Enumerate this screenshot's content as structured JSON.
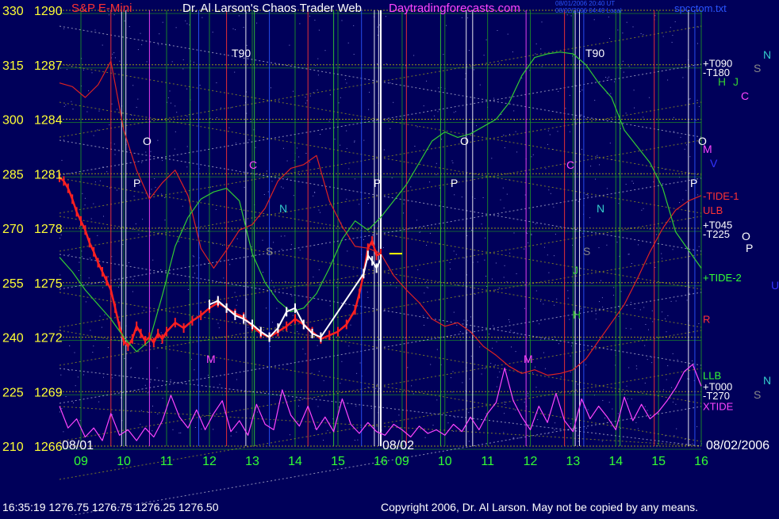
{
  "header": {
    "instrument": "S&P E-Mini",
    "site_title": "Dr. Al Larson's Chaos Trader Web",
    "site_url": "Daytradingforecasts.com",
    "stamp_line1": "08/01/2006 20:40 UT",
    "stamp_line2": "08/02/2006 04:40 Local",
    "file_name": "spcctom.txt"
  },
  "footer": {
    "quote": "16:35:19  1276.75 1276.75 1276.25 1276.50",
    "copyright": "Copyright 2006, Dr. Al Larson. May not be copied by any means."
  },
  "chart_data": {
    "type": "line",
    "title": "S&P E-Mini",
    "y_axis": {
      "price_ticks": [
        "1290",
        "1287",
        "1284",
        "1281",
        "1278",
        "1275",
        "1272",
        "1269",
        "1266"
      ],
      "angle_ticks": [
        "330",
        "315",
        "300",
        "285",
        "270",
        "255",
        "240",
        "225",
        "210"
      ],
      "ylim": [
        1266,
        1290
      ]
    },
    "x_axis": {
      "hour_ticks": [
        "09",
        "10",
        "11",
        "12",
        "13",
        "14",
        "15",
        "16",
        "09",
        "10",
        "11",
        "12",
        "13",
        "14",
        "15",
        "16"
      ],
      "date_labels": [
        "08/01",
        "08/02",
        "08/02/2006"
      ],
      "session_hours": [
        8.5,
        16
      ]
    },
    "flux_labels": [
      {
        "text": "+T090",
        "price": 1287.1,
        "color": "#ffffff"
      },
      {
        "text": "-T180",
        "price": 1286.6,
        "color": "#ffffff"
      },
      {
        "text": "-TIDE-1",
        "price": 1279.8,
        "color": "#ff3333"
      },
      {
        "text": "ULB",
        "price": 1279.0,
        "color": "#ff3333"
      },
      {
        "text": "+T045",
        "price": 1278.2,
        "color": "#ffffff"
      },
      {
        "text": "-T225",
        "price": 1277.7,
        "color": "#ffffff"
      },
      {
        "text": "+TIDE-2",
        "price": 1275.3,
        "color": "#33ff33"
      },
      {
        "text": "R",
        "price": 1273.0,
        "color": "#ff3333"
      },
      {
        "text": "LLB",
        "price": 1269.9,
        "color": "#33ff33"
      },
      {
        "text": "+T000",
        "price": 1269.3,
        "color": "#ffffff"
      },
      {
        "text": "-T270",
        "price": 1268.8,
        "color": "#ffffff"
      },
      {
        "text": "XTIDE",
        "price": 1268.2,
        "color": "#ff44ff"
      }
    ],
    "planet_labels": [
      {
        "text": "N",
        "color": "#33cccc"
      },
      {
        "text": "S",
        "color": "#888888"
      },
      {
        "text": "H",
        "color": "#33cc33"
      },
      {
        "text": "J",
        "color": "#33cc33"
      },
      {
        "text": "C",
        "color": "#ff44ff"
      },
      {
        "text": "O",
        "color": "#ffffff"
      },
      {
        "text": "M",
        "color": "#ff44ff"
      },
      {
        "text": "V",
        "color": "#3333ff"
      },
      {
        "text": "P",
        "color": "#ffffff"
      },
      {
        "text": "U",
        "color": "#3333ff"
      },
      {
        "text": "T90",
        "color": "#ffffff"
      }
    ],
    "series": [
      {
        "name": "price",
        "color": "#ff2020",
        "x": [
          8.5,
          8.6,
          8.7,
          8.8,
          8.9,
          9.0,
          9.1,
          9.2,
          9.3,
          9.4,
          9.5,
          9.6,
          9.7,
          9.8,
          9.9,
          10.0,
          10.1,
          10.2,
          10.3,
          10.4,
          10.5,
          10.6,
          10.7,
          10.8,
          10.9,
          11.0,
          11.2,
          11.4,
          11.6,
          11.8,
          12.0,
          12.2,
          12.4,
          12.6,
          12.8,
          13.0,
          13.2,
          13.4,
          13.6,
          13.8,
          14.0,
          14.2,
          14.4,
          14.6,
          14.8,
          15.0,
          15.2,
          15.4,
          15.5,
          15.6,
          15.7,
          15.8,
          15.9,
          16.0
        ],
        "y": [
          1280.8,
          1280.6,
          1280.2,
          1279.6,
          1278.9,
          1278.4,
          1277.9,
          1277.2,
          1276.7,
          1276.1,
          1275.6,
          1275.1,
          1274.6,
          1273.6,
          1272.6,
          1271.8,
          1271.5,
          1271.9,
          1272.6,
          1272.2,
          1271.8,
          1272.0,
          1271.7,
          1272.2,
          1271.9,
          1272.3,
          1272.8,
          1272.5,
          1272.9,
          1273.2,
          1273.6,
          1273.9,
          1273.6,
          1273.3,
          1273.1,
          1272.6,
          1272.2,
          1272.0,
          1272.3,
          1272.6,
          1273.0,
          1272.7,
          1272.3,
          1271.9,
          1272.1,
          1272.3,
          1272.7,
          1273.5,
          1274.4,
          1275.5,
          1276.9,
          1277.3,
          1276.5,
          1276.6
        ]
      },
      {
        "name": "flux-red",
        "color": "#dd2222",
        "x": [
          8.5,
          8.8,
          9.1,
          9.4,
          9.7,
          10.0,
          10.3,
          10.6,
          10.9,
          11.2,
          11.5,
          11.8,
          12.1,
          12.4,
          12.7,
          13.0,
          13.3,
          13.6,
          13.9,
          14.2,
          14.5,
          14.8,
          15.1,
          15.4,
          15.7,
          16.0,
          16.3,
          16.6,
          16.9,
          17.2,
          17.5,
          17.8,
          18.1,
          18.4,
          18.7,
          19.0,
          19.3,
          19.6,
          19.9,
          20.2,
          20.5,
          20.8,
          21.1,
          21.4,
          21.7,
          22.0,
          22.3,
          22.6,
          22.9,
          23.2,
          23.5
        ],
        "y": [
          1286.0,
          1285.8,
          1285.2,
          1285.9,
          1287.2,
          1283.4,
          1281.2,
          1279.6,
          1280.5,
          1281.2,
          1279.8,
          1276.9,
          1275.8,
          1276.8,
          1277.9,
          1278.2,
          1279.1,
          1280.6,
          1281.3,
          1281.5,
          1282.0,
          1279.5,
          1278.1,
          1277.0,
          1276.9,
          1276.6,
          1275.4,
          1274.6,
          1273.9,
          1273.0,
          1272.6,
          1272.8,
          1272.3,
          1271.5,
          1271.0,
          1270.4,
          1270.0,
          1270.2,
          1269.9,
          1270.0,
          1270.2,
          1270.8,
          1271.8,
          1272.8,
          1273.8,
          1275.2,
          1276.7,
          1278.0,
          1279.0,
          1279.5,
          1279.8
        ]
      },
      {
        "name": "flux-green",
        "color": "#33cc33",
        "x": [
          8.5,
          8.8,
          9.1,
          9.4,
          9.7,
          10.0,
          10.3,
          10.6,
          10.9,
          11.2,
          11.5,
          11.8,
          12.1,
          12.4,
          12.7,
          13.0,
          13.3,
          13.6,
          13.9,
          14.2,
          14.5,
          14.8,
          15.1,
          15.4,
          15.7,
          16.0,
          16.3,
          16.6,
          16.9,
          17.2,
          17.5,
          17.8,
          18.1,
          18.4,
          18.7,
          19.0,
          19.3,
          19.6,
          19.9,
          20.2,
          20.5,
          20.8,
          21.1,
          21.4,
          21.7,
          22.0,
          22.3,
          22.6,
          22.9,
          23.2,
          23.5
        ],
        "y": [
          1276.4,
          1275.6,
          1274.6,
          1273.8,
          1273.0,
          1272.0,
          1271.2,
          1271.8,
          1274.3,
          1277.0,
          1278.6,
          1279.6,
          1280.0,
          1280.2,
          1279.5,
          1276.6,
          1275.0,
          1274.0,
          1273.4,
          1273.6,
          1274.4,
          1275.8,
          1277.4,
          1278.4,
          1277.9,
          1278.6,
          1279.5,
          1280.4,
          1281.6,
          1282.8,
          1283.3,
          1283.0,
          1283.2,
          1283.6,
          1284.0,
          1284.9,
          1286.4,
          1287.4,
          1287.6,
          1287.7,
          1287.6,
          1287.0,
          1286.0,
          1285.2,
          1283.4,
          1282.5,
          1281.6,
          1280.2,
          1277.8,
          1276.8,
          1275.8
        ]
      },
      {
        "name": "flux-magenta",
        "color": "#ff44ff",
        "x": [
          8.5,
          8.7,
          8.9,
          9.1,
          9.3,
          9.5,
          9.7,
          9.9,
          10.1,
          10.3,
          10.5,
          10.7,
          10.9,
          11.1,
          11.3,
          11.5,
          11.7,
          11.9,
          12.1,
          12.3,
          12.5,
          12.7,
          12.9,
          13.1,
          13.3,
          13.5,
          13.7,
          13.9,
          14.1,
          14.3,
          14.5,
          14.7,
          14.9,
          15.1,
          15.3,
          15.5,
          15.7,
          15.9,
          16.1,
          16.3,
          16.5,
          16.7,
          16.9,
          17.1,
          17.3,
          17.5,
          17.7,
          17.9,
          18.1,
          18.3,
          18.5,
          18.7,
          18.9,
          19.1,
          19.3,
          19.5,
          19.7,
          19.9,
          20.1,
          20.3,
          20.5,
          20.7,
          20.9,
          21.1,
          21.3,
          21.5,
          21.7,
          21.9,
          22.1,
          22.3,
          22.5,
          22.7,
          22.9,
          23.1,
          23.3,
          23.5
        ],
        "y": [
          1268.2,
          1267.0,
          1267.5,
          1266.5,
          1267.0,
          1266.3,
          1267.8,
          1266.6,
          1266.9,
          1266.3,
          1267.0,
          1266.5,
          1267.4,
          1268.8,
          1267.6,
          1267.0,
          1268.0,
          1266.9,
          1267.8,
          1268.5,
          1266.8,
          1267.4,
          1266.6,
          1268.3,
          1267.2,
          1266.9,
          1269.1,
          1267.7,
          1267.1,
          1268.2,
          1266.9,
          1267.6,
          1266.8,
          1268.6,
          1267.2,
          1266.7,
          1267.3,
          1266.8,
          1266.6,
          1267.2,
          1266.9,
          1266.5,
          1267.1,
          1266.7,
          1266.9,
          1266.6,
          1267.2,
          1266.8,
          1267.6,
          1266.9,
          1267.8,
          1268.4,
          1270.3,
          1268.5,
          1267.6,
          1266.9,
          1268.2,
          1267.3,
          1268.9,
          1267.4,
          1266.8,
          1268.6,
          1267.5,
          1268.2,
          1267.6,
          1266.9,
          1268.7,
          1267.4,
          1268.3,
          1267.5,
          1267.9,
          1268.5,
          1269.2,
          1270.1,
          1270.5,
          1269.3
        ]
      },
      {
        "name": "white-bars",
        "color": "#ffffff",
        "x": [
          12.0,
          12.2,
          12.4,
          12.6,
          12.8,
          13.0,
          13.2,
          13.4,
          13.6,
          13.8,
          14.0,
          14.2,
          14.4,
          14.6,
          15.6,
          15.7,
          15.8,
          15.9,
          16.0
        ],
        "y": [
          1273.8,
          1274.0,
          1273.6,
          1273.2,
          1273.0,
          1272.7,
          1272.3,
          1272.0,
          1272.5,
          1273.4,
          1273.6,
          1272.7,
          1272.2,
          1272.0,
          1275.5,
          1276.5,
          1276.2,
          1275.8,
          1276.3
        ]
      }
    ]
  }
}
